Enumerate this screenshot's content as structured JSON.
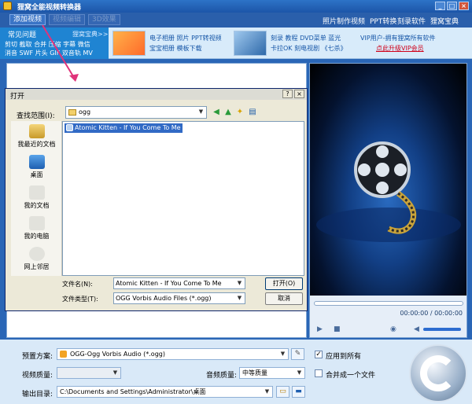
{
  "window": {
    "title": "狸窝全能视频转换器",
    "buttons": {
      "min": "_",
      "max": "□",
      "close": "×"
    }
  },
  "toolbar": {
    "add_video": "添加视频",
    "btn2": "视频编辑",
    "btn3": "3D效果",
    "links": [
      "照片制作视频",
      "PPT转换",
      "刻录软件",
      "狸窝宝典"
    ]
  },
  "adbar": {
    "faq_title": "常见问题",
    "faq_more": "狸窝宝典>>",
    "faq_row1": "剪切 截取 合并 压缩 字幕 微信",
    "faq_row2": "消音 SWF 片头 GIF 双音轨 MV",
    "album_line1": "电子相册 照片 PPT转视频",
    "album_line2": "宝宝相册 模板下载",
    "dvd_line1": "刻录 教程 DVD菜单 蓝光",
    "dvd_line2": "卡拉OK 刻电视剧 《七杀》",
    "vip_line1": "VIP用户-拥有狸窝所有软件",
    "vip_line2": "点此升级VIP会员",
    "vip_color": "#d0021b"
  },
  "dialog": {
    "title": "打开",
    "close": "×",
    "lookin_label": "查找范围(I):",
    "lookin_value": "ogg",
    "places": [
      "我最近的文档",
      "桌面",
      "我的文档",
      "我的电脑",
      "网上邻居"
    ],
    "files": [
      "Atomic Kitten - If You Come To Me"
    ],
    "filename_label": "文件名(N):",
    "filename_value": "Atomic Kitten - If You Come To Me",
    "filetype_label": "文件类型(T):",
    "filetype_value": "OGG Vorbis Audio Files (*.ogg)",
    "open_button": "打开(O)",
    "cancel_button": "取消"
  },
  "preview": {
    "time": "00:00:00 / 00:00:00"
  },
  "bottom": {
    "preset_label": "预置方案:",
    "preset_value": "OGG-Ogg Vorbis Audio (*.ogg)",
    "apply_all": "应用到所有",
    "video_quality_label": "视频质量:",
    "audio_quality_label": "音频质量:",
    "audio_quality_value": "中等质量",
    "merge_label": "合并成一个文件",
    "output_label": "输出目录:",
    "output_value": "C:\\Documents and Settings\\Administrator\\桌面"
  }
}
